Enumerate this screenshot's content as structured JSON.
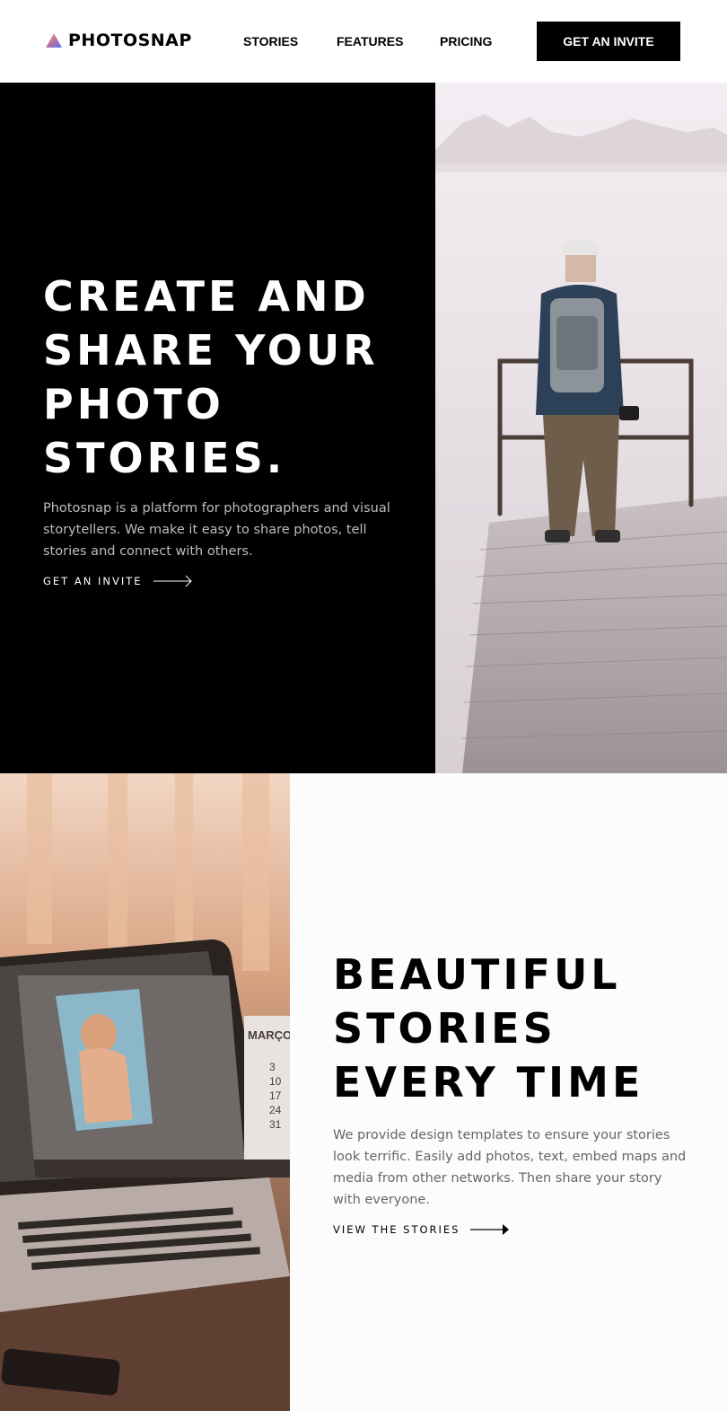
{
  "header": {
    "logo_text": "PHOTOSNAP",
    "nav": [
      "STORIES",
      "FEATURES",
      "PRICING"
    ],
    "cta_label": "GET AN INVITE"
  },
  "hero": {
    "title_lines": [
      "CREATE AND",
      "SHARE YOUR",
      "PHOTO",
      "STORIES."
    ],
    "description": "Photosnap is a platform for photographers and visual storytellers. We make it easy to share photos, tell stories and connect with others.",
    "link_label": "GET AN INVITE"
  },
  "beautiful": {
    "title_lines": [
      "BEAUTIFUL",
      "STORIES",
      "EVERY TIME"
    ],
    "description": "We provide design templates to ensure your stories look terrific. Easily add photos, text, embed maps and media from other networks. Then share your story with everyone.",
    "link_label": "VIEW THE STORIES"
  },
  "laptop_screen": {
    "calendar_label": "MARÇO",
    "calendar_dates": [
      "3",
      "10",
      "17",
      "24",
      "31"
    ]
  },
  "colors": {
    "logo_gradient": [
      "#ffc593",
      "#bc7198",
      "#5a77ff"
    ],
    "dark": "#000000",
    "light_panel": "#fdfcfd"
  }
}
